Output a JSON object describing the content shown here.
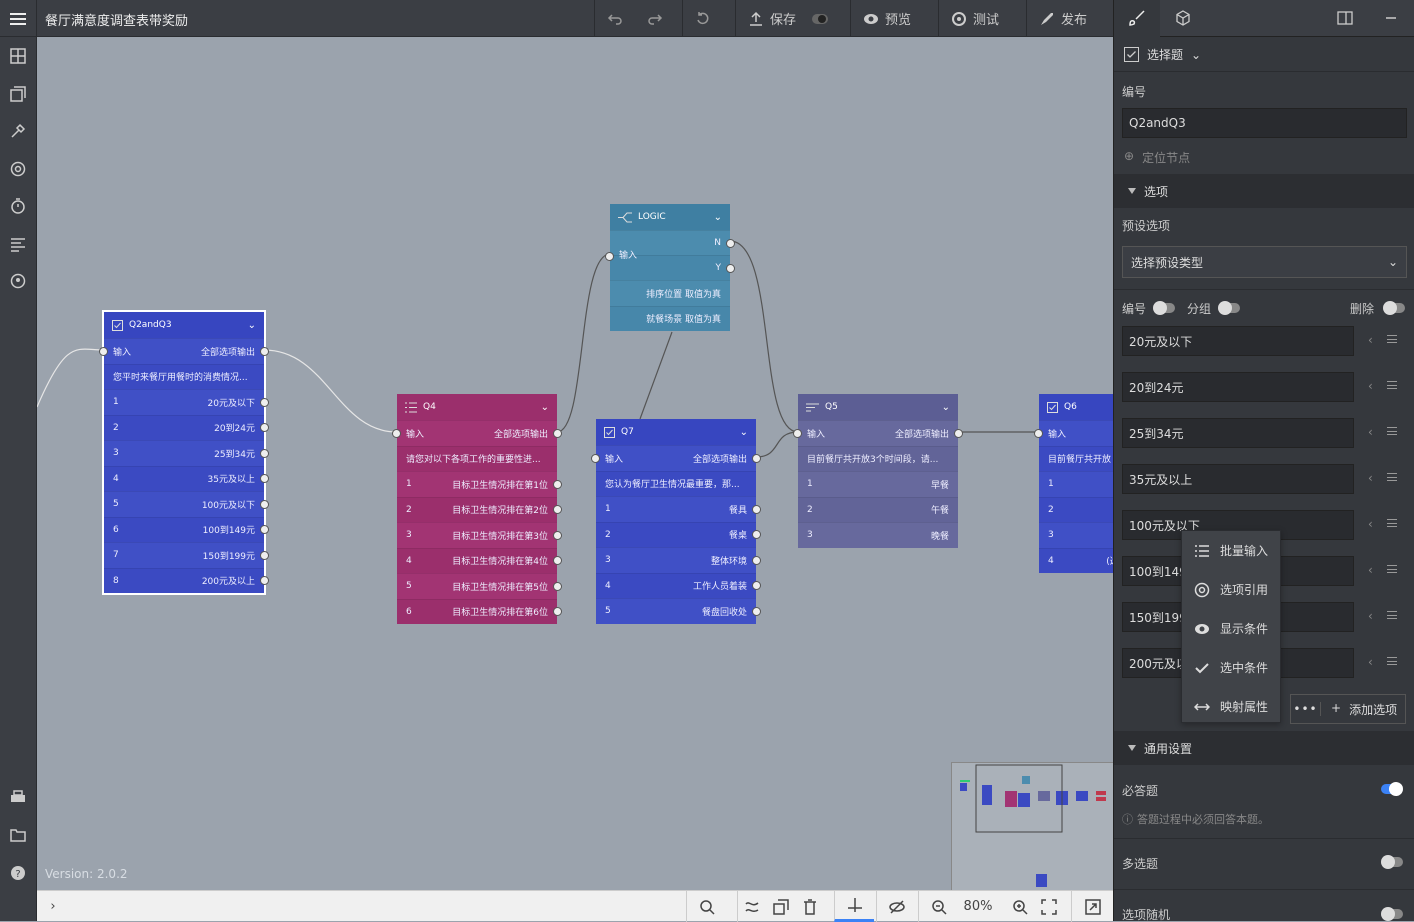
{
  "app": {
    "title": "餐厅满意度调查表带奖励",
    "version": "Version: 2.0.2"
  },
  "toolbar": {
    "save": "保存",
    "preview": "预览",
    "test": "测试",
    "publish": "发布"
  },
  "nodes": {
    "q2q3": {
      "title": "Q2andQ3",
      "input": "输入",
      "output": "全部选项输出",
      "question": "您平时来餐厅用餐时的消费情况...",
      "options": [
        {
          "n": "1",
          "t": "20元及以下"
        },
        {
          "n": "2",
          "t": "20到24元"
        },
        {
          "n": "3",
          "t": "25到34元"
        },
        {
          "n": "4",
          "t": "35元及以上"
        },
        {
          "n": "5",
          "t": "100元及以下"
        },
        {
          "n": "6",
          "t": "100到149元"
        },
        {
          "n": "7",
          "t": "150到199元"
        },
        {
          "n": "8",
          "t": "200元及以上"
        }
      ]
    },
    "logic": {
      "title": "LOGIC",
      "input": "输入",
      "n": "N",
      "y": "Y",
      "cond1": "排序位置 取值为真",
      "cond2": "就餐场景 取值为真"
    },
    "q4": {
      "title": "Q4",
      "input": "输入",
      "output": "全部选项输出",
      "question": "请您对以下各项工作的重要性进...",
      "options": [
        {
          "n": "1",
          "t": "目标卫生情况排在第1位"
        },
        {
          "n": "2",
          "t": "目标卫生情况排在第2位"
        },
        {
          "n": "3",
          "t": "目标卫生情况排在第3位"
        },
        {
          "n": "4",
          "t": "目标卫生情况排在第4位"
        },
        {
          "n": "5",
          "t": "目标卫生情况排在第5位"
        },
        {
          "n": "6",
          "t": "目标卫生情况排在第6位"
        }
      ]
    },
    "q7": {
      "title": "Q7",
      "input": "输入",
      "output": "全部选项输出",
      "question": "您认为餐厅卫生情况最重要，那...",
      "options": [
        {
          "n": "1",
          "t": "餐具"
        },
        {
          "n": "2",
          "t": "餐桌"
        },
        {
          "n": "3",
          "t": "整体环境"
        },
        {
          "n": "4",
          "t": "工作人员着装"
        },
        {
          "n": "5",
          "t": "餐盘回收处"
        }
      ]
    },
    "q5": {
      "title": "Q5",
      "input": "输入",
      "output": "全部选项输出",
      "question": "目前餐厅共开放3个时间段，请...",
      "options": [
        {
          "n": "1",
          "t": "早餐"
        },
        {
          "n": "2",
          "t": "午餐"
        },
        {
          "n": "3",
          "t": "晚餐"
        }
      ]
    },
    "q6": {
      "title": "Q6",
      "input": "输入",
      "question": "目前餐厅共开放",
      "options": [
        {
          "n": "1",
          "t": ""
        },
        {
          "n": "2",
          "t": ""
        },
        {
          "n": "3",
          "t": ""
        },
        {
          "n": "4",
          "t": "(选项 + 备"
        }
      ]
    }
  },
  "bottom": {
    "zoom": "80%"
  },
  "panel": {
    "type_label": "选择题",
    "id_label": "编号",
    "id_value": "Q2andQ3",
    "locate": "定位节点",
    "options_section": "选项",
    "preset_label": "预设选项",
    "preset_select": "选择预设类型",
    "num_toggle": "编号",
    "group_toggle": "分组",
    "delete_toggle": "删除",
    "options": [
      "20元及以下",
      "20到24元",
      "25到34元",
      "35元及以上",
      "100元及以下",
      "100到149元",
      "150到199元",
      "200元及以上"
    ],
    "add_option": "添加选项",
    "general_section": "通用设置",
    "required": "必答题",
    "required_hint": "答题过程中必须回答本题。",
    "multi": "多选题",
    "random": "选项随机"
  },
  "popup": {
    "items": [
      "批量输入",
      "选项引用",
      "显示条件",
      "选中条件",
      "映射属性"
    ]
  }
}
